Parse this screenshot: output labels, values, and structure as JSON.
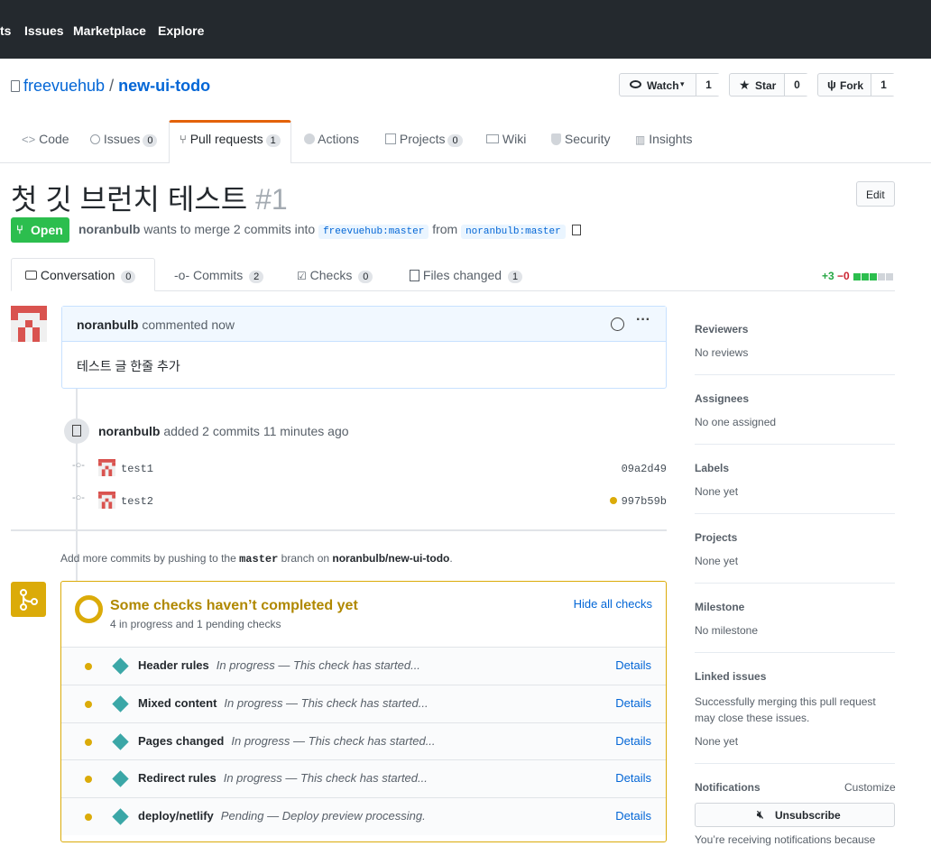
{
  "topnav": {
    "items": [
      "ts",
      "Issues",
      "Marketplace",
      "Explore"
    ]
  },
  "repo": {
    "owner": "freevuehub",
    "sep": "/",
    "name": "new-ui-todo"
  },
  "actions": {
    "watch": {
      "label": "Watch",
      "count": "1"
    },
    "star": {
      "label": "Star",
      "count": "0"
    },
    "fork": {
      "label": "Fork",
      "count": "1"
    }
  },
  "repo_tabs": [
    {
      "label": "Code"
    },
    {
      "label": "Issues",
      "count": "0"
    },
    {
      "label": "Pull requests",
      "count": "1"
    },
    {
      "label": "Actions"
    },
    {
      "label": "Projects",
      "count": "0"
    },
    {
      "label": "Wiki"
    },
    {
      "label": "Security"
    },
    {
      "label": "Insights"
    }
  ],
  "pr": {
    "title": "첫 깃 브런치 테스트",
    "number": "#1",
    "edit_label": "Edit",
    "state": "Open",
    "author": "noranbulb",
    "merge_text": "wants to merge 2 commits into",
    "base_branch": "freevuehub:master",
    "from_text": "from",
    "head_branch": "noranbulb:master"
  },
  "pr_tabs": [
    {
      "label": "Conversation",
      "count": "0"
    },
    {
      "label": "Commits",
      "count": "2"
    },
    {
      "label": "Checks",
      "count": "0"
    },
    {
      "label": "Files changed",
      "count": "1"
    }
  ],
  "diffstat": {
    "add": "+3",
    "del": "−0"
  },
  "comment": {
    "author": "noranbulb",
    "meta": "commented now",
    "body": "테스트 글 한줄 추가"
  },
  "commits_event": {
    "author": "noranbulb",
    "text": "added 2 commits 11 minutes ago"
  },
  "commits": [
    {
      "message": "test1",
      "sha": "09a2d49",
      "pending": false
    },
    {
      "message": "test2",
      "sha": "997b59b",
      "pending": true
    }
  ],
  "push_hint": {
    "prefix": "Add more commits by pushing to the",
    "branch": "master",
    "middle": "branch on",
    "repo": "noranbulb/new-ui-todo",
    "suffix": "."
  },
  "checks": {
    "title": "Some checks haven’t completed yet",
    "subtitle": "4 in progress and 1 pending checks",
    "toggle": "Hide all checks",
    "items": [
      {
        "name": "Header rules",
        "desc": "In progress — This check has started...",
        "link": "Details"
      },
      {
        "name": "Mixed content",
        "desc": "In progress — This check has started...",
        "link": "Details"
      },
      {
        "name": "Pages changed",
        "desc": "In progress — This check has started...",
        "link": "Details"
      },
      {
        "name": "Redirect rules",
        "desc": "In progress — This check has started...",
        "link": "Details"
      },
      {
        "name": "deploy/netlify",
        "desc": "Pending — Deploy preview processing.",
        "link": "Details"
      }
    ]
  },
  "sidebar": {
    "reviewers": {
      "title": "Reviewers",
      "value": "No reviews"
    },
    "assignees": {
      "title": "Assignees",
      "value": "No one assigned"
    },
    "labels": {
      "title": "Labels",
      "value": "None yet"
    },
    "projects": {
      "title": "Projects",
      "value": "None yet"
    },
    "milestone": {
      "title": "Milestone",
      "value": "No milestone"
    },
    "linked": {
      "title": "Linked issues",
      "desc": "Successfully merging this pull request may close these issues.",
      "value": "None yet"
    },
    "notifications": {
      "title": "Notifications",
      "customize": "Customize",
      "button": "Unsubscribe",
      "footer": "You’re receiving notifications because"
    }
  },
  "colors": {
    "header_bg": "#24292e",
    "open_green": "#2cbe4e",
    "pending_yellow": "#dbab09",
    "tab_orange": "#e36209",
    "link_blue": "#0366d6"
  }
}
